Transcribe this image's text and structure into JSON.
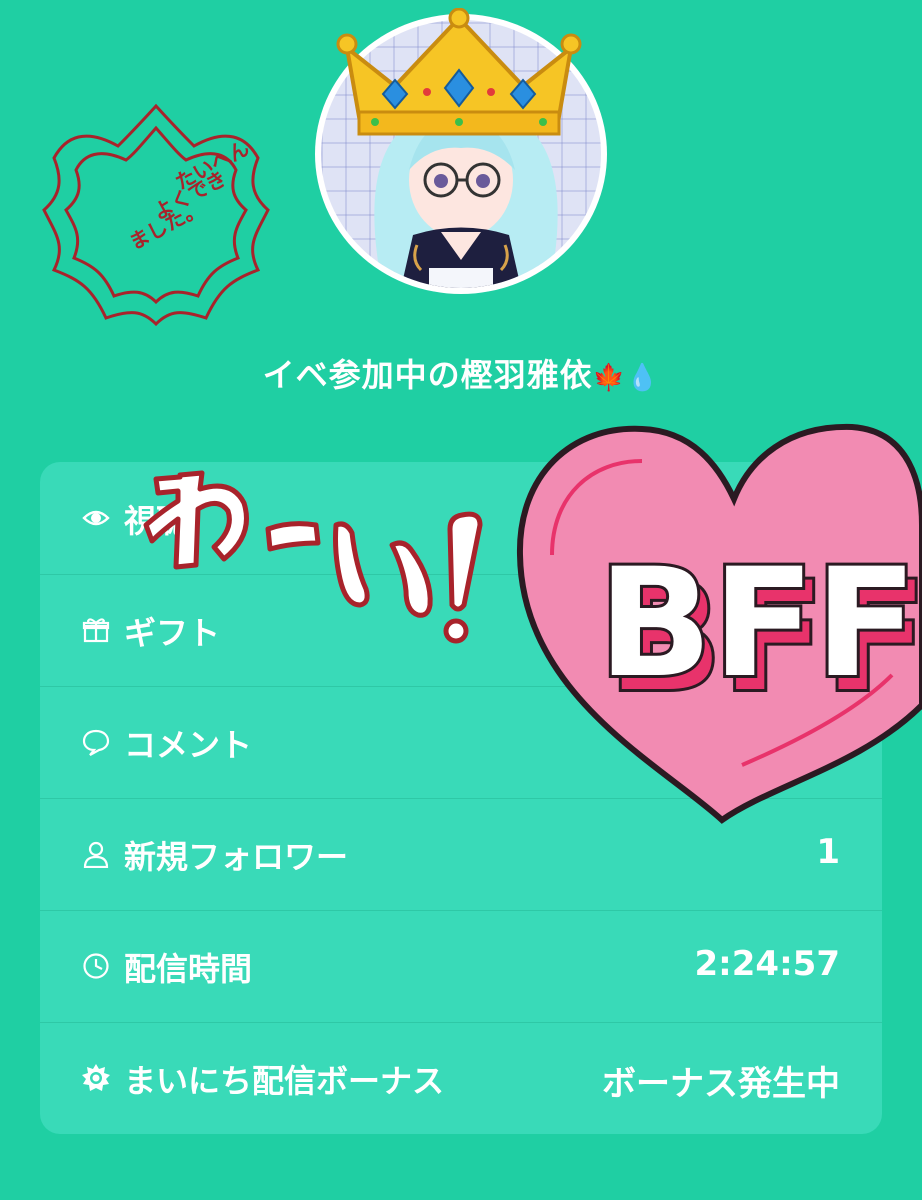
{
  "profile": {
    "username": "イベ参加中の樫羽雅依",
    "name_emoji_1": "🍁",
    "name_emoji_2": "💧",
    "avatar_name": "avatar"
  },
  "stamp": {
    "text_lines": [
      "たいへん",
      "よくでき",
      "ました。"
    ],
    "color": "#a8232b"
  },
  "stickers": {
    "waai_text": "わーい!",
    "bff_text": "BFF"
  },
  "stats": {
    "rows": [
      {
        "icon": "eye-icon",
        "label": "視聴",
        "value": ""
      },
      {
        "icon": "gift-icon",
        "label": "ギフト",
        "value": ""
      },
      {
        "icon": "comment-icon",
        "label": "コメント",
        "value": ""
      },
      {
        "icon": "person-icon",
        "label": "新規フォロワー",
        "value": "1"
      },
      {
        "icon": "clock-icon",
        "label": "配信時間",
        "value": "2:24:57"
      },
      {
        "icon": "sun-icon",
        "label": "まいにち配信ボーナス",
        "value": "ボーナス発生中"
      }
    ]
  },
  "colors": {
    "background": "#1fcfa3",
    "card": "#39dab8",
    "heart": "#f28bb2",
    "heart_outline": "#2b1a22",
    "bff_shadow": "#e8336b"
  }
}
